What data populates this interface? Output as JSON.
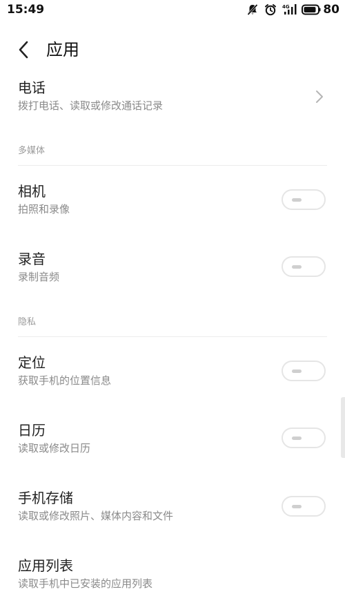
{
  "status_bar": {
    "time": "15:49",
    "network": "4G",
    "battery": "80",
    "icons": [
      "notifications-off-icon",
      "alarm-icon",
      "signal-icon",
      "battery-icon"
    ]
  },
  "header": {
    "title": "应用"
  },
  "items": [
    {
      "title": "电话",
      "subtitle": "拨打电话、读取或修改通话记录",
      "control": "chevron"
    },
    {
      "title": "相机",
      "subtitle": "拍照和录像",
      "control": "toggle",
      "enabled": false
    },
    {
      "title": "录音",
      "subtitle": "录制音频",
      "control": "toggle",
      "enabled": false
    },
    {
      "title": "定位",
      "subtitle": "获取手机的位置信息",
      "control": "toggle",
      "enabled": false
    },
    {
      "title": "日历",
      "subtitle": "读取或修改日历",
      "control": "toggle",
      "enabled": false
    },
    {
      "title": "手机存储",
      "subtitle": "读取或修改照片、媒体内容和文件",
      "control": "toggle",
      "enabled": false
    },
    {
      "title": "应用列表",
      "subtitle": "读取手机中已安装的应用列表",
      "control": "none"
    }
  ],
  "sections": {
    "multimedia": "多媒体",
    "privacy": "隐私"
  },
  "colors": {
    "background": "#ffffff",
    "primary_text": "#222222",
    "secondary_text": "#8a8a8a",
    "section_text": "#9a9a9a",
    "toggle_border": "#e5e5e5",
    "toggle_knob": "#cfcfcf"
  }
}
